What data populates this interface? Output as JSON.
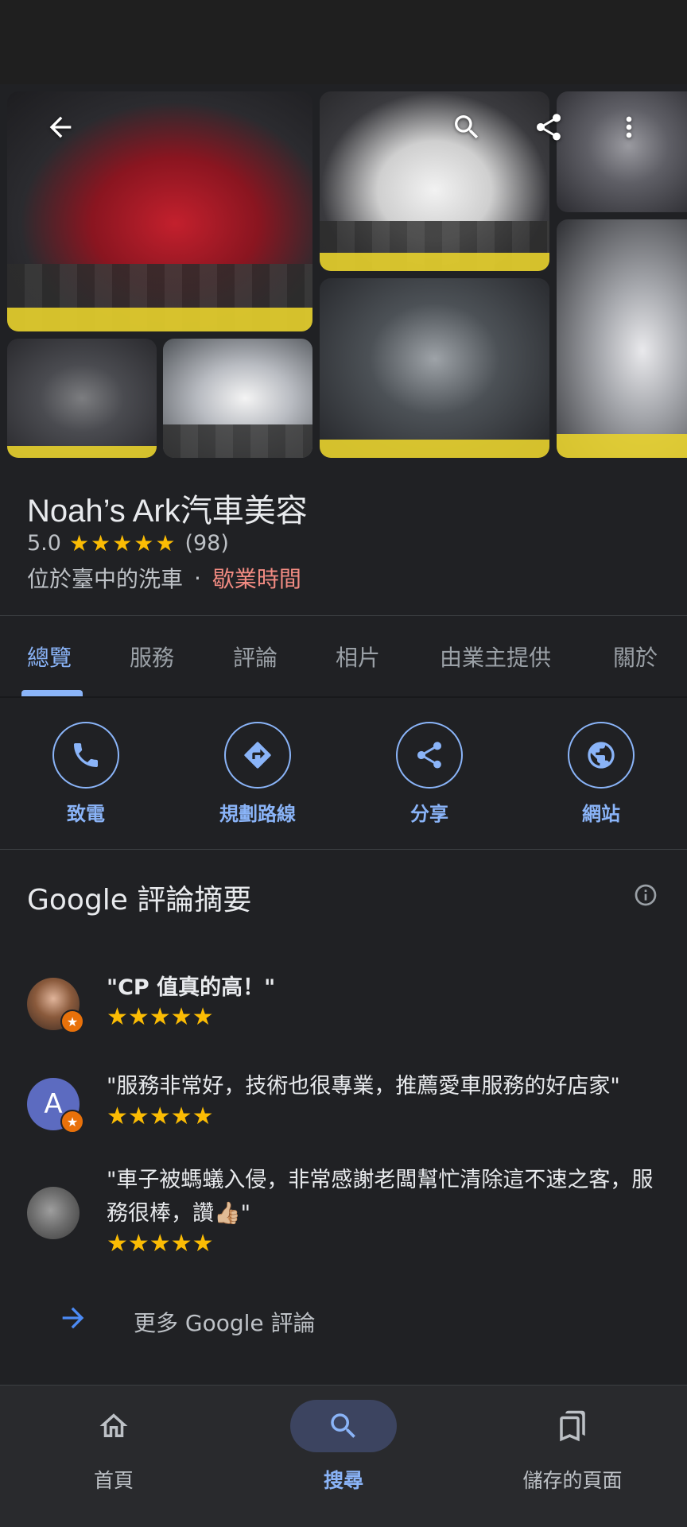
{
  "place": {
    "name": "Noah’s Ark汽車美容",
    "rating": "5.0",
    "stars": "★★★★★",
    "review_count": "(98)",
    "category": "位於臺中的洗車",
    "separator": "·",
    "hours_link": "歇業時間"
  },
  "top_actions": {
    "back_icon": "arrow-left-icon",
    "search_icon": "search-icon",
    "share_icon": "share-icon",
    "more_icon": "more-vert-icon"
  },
  "tabs": [
    {
      "label": "總覽",
      "active": true
    },
    {
      "label": "服務"
    },
    {
      "label": "評論"
    },
    {
      "label": "相片"
    },
    {
      "label": "由業主提供"
    },
    {
      "label": "關於"
    }
  ],
  "actions": [
    {
      "label": "致電",
      "icon": "phone-icon"
    },
    {
      "label": "規劃路線",
      "icon": "directions-icon"
    },
    {
      "label": "分享",
      "icon": "share-icon"
    },
    {
      "label": "網站",
      "icon": "globe-icon"
    }
  ],
  "summary": {
    "title": "Google 評論摘要",
    "reviews": [
      {
        "quote": "\"CP 值真的高！\"",
        "stars": "★★★★★"
      },
      {
        "quote": "\"服務非常好，技術也很專業，推薦愛車服務的好店家\"",
        "stars": "★★★★★",
        "avatar_letter": "A"
      },
      {
        "quote": "\"車子被螞蟻入侵，非常感謝老闆幫忙清除這不速之客，服務很棒，讚👍🏼\"",
        "stars": "★★★★★"
      }
    ],
    "more_label": "更多 Google 評論"
  },
  "bottom_nav": [
    {
      "label": "首頁",
      "icon": "home-icon"
    },
    {
      "label": "搜尋",
      "icon": "search-icon",
      "active": true
    },
    {
      "label": "儲存的頁面",
      "icon": "bookmarks-icon"
    }
  ],
  "colors": {
    "accent": "#8ab4f8",
    "star": "#fbbc04",
    "hours": "#f28b82",
    "background": "#202124"
  }
}
